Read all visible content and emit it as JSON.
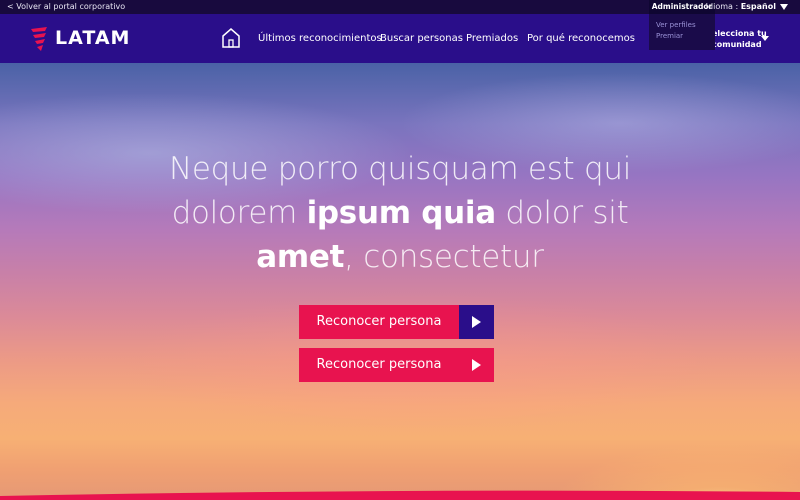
{
  "topbar": {
    "back_label": "< Volver al portal corporativo",
    "language_prefix": "Idioma : ",
    "language_value": "Español",
    "admin_label": "Administrador"
  },
  "admin_menu": {
    "items": [
      "Ver perfiles",
      "Premiar"
    ]
  },
  "nav": {
    "logo_text": "LATAM",
    "items": [
      "Últimos reconocimientos",
      "Buscar personas",
      "Premiados",
      "Por qué reconocemos"
    ],
    "community_line1": "elecciona tu",
    "community_line2": "comunidad"
  },
  "hero": {
    "title_part1": "Neque porro quisquam est qui dolorem ",
    "title_bold1": "ipsum quia",
    "title_part2": " dolor sit ",
    "title_bold2": "amet",
    "title_part3": ", consectetur"
  },
  "buttons": {
    "primary_label": "Reconocer persona",
    "secondary_label": "Reconocer persona"
  },
  "colors": {
    "brand_indigo": "#2a0e8a",
    "brand_coral": "#e8134f",
    "topbar": "#180a3e"
  }
}
